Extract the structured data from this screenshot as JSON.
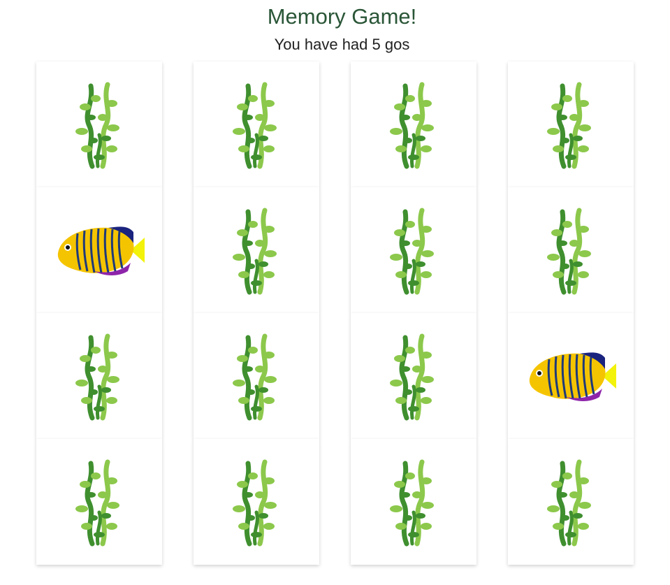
{
  "title": "Memory Game!",
  "status": "You have had 5 gos",
  "cards": [
    {
      "face": "seaweed"
    },
    {
      "face": "seaweed"
    },
    {
      "face": "seaweed"
    },
    {
      "face": "seaweed"
    },
    {
      "face": "fish"
    },
    {
      "face": "seaweed"
    },
    {
      "face": "seaweed"
    },
    {
      "face": "seaweed"
    },
    {
      "face": "seaweed"
    },
    {
      "face": "seaweed"
    },
    {
      "face": "seaweed"
    },
    {
      "face": "fish"
    },
    {
      "face": "seaweed"
    },
    {
      "face": "seaweed"
    },
    {
      "face": "seaweed"
    },
    {
      "face": "seaweed"
    }
  ],
  "colors": {
    "title": "#2a5637",
    "seaweed_dark": "#3f8f2f",
    "seaweed_light": "#8cc84b",
    "fish_yellow": "#f5c400",
    "fish_stripe": "#1e3a7a",
    "fish_tail": "#f2f20a"
  }
}
